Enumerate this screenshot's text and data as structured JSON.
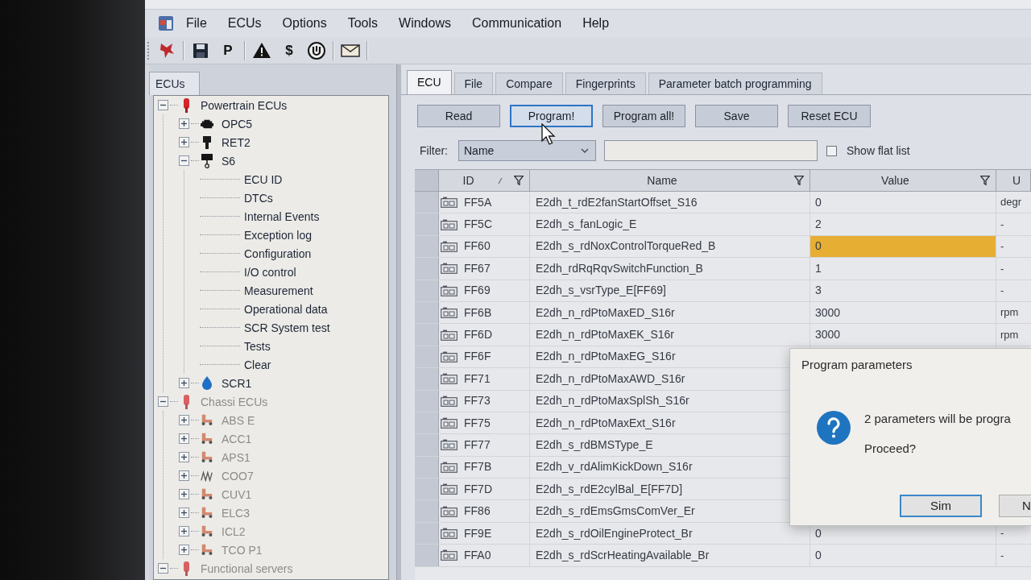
{
  "menu_bar": {
    "items": [
      "File",
      "ECUs",
      "Options",
      "Tools",
      "Windows",
      "Communication",
      "Help"
    ]
  },
  "toolbar": [
    {
      "kind": "emblem"
    },
    {
      "kind": "separator"
    },
    {
      "kind": "save"
    },
    {
      "kind": "glyph",
      "text": "P"
    },
    {
      "kind": "separator"
    },
    {
      "kind": "warning"
    },
    {
      "kind": "glyph",
      "text": "$"
    },
    {
      "kind": "dial"
    },
    {
      "kind": "separator"
    },
    {
      "kind": "mail"
    },
    {
      "kind": "separator"
    }
  ],
  "ecu_panel": {
    "title": "ECUs",
    "tree": [
      {
        "label": "Powertrain ECUs",
        "kind": "group",
        "expanded": true,
        "disabled": false,
        "children": [
          {
            "label": "OPC5",
            "kind": "engine",
            "expanded": false,
            "disabled": false
          },
          {
            "label": "RET2",
            "kind": "retarder",
            "expanded": false,
            "disabled": false
          },
          {
            "label": "S6",
            "kind": "controller",
            "expanded": true,
            "disabled": false,
            "children": [
              {
                "label": "ECU ID",
                "kind": "function"
              },
              {
                "label": "DTCs",
                "kind": "function"
              },
              {
                "label": "Internal Events",
                "kind": "function"
              },
              {
                "label": "Exception log",
                "kind": "function"
              },
              {
                "label": "Configuration",
                "kind": "function"
              },
              {
                "label": "I/O control",
                "kind": "function"
              },
              {
                "label": "Measurement",
                "kind": "function"
              },
              {
                "label": "Operational data",
                "kind": "function"
              },
              {
                "label": "SCR System test",
                "kind": "function"
              },
              {
                "label": "Tests",
                "kind": "function"
              },
              {
                "label": "Clear",
                "kind": "function"
              }
            ]
          },
          {
            "label": "SCR1",
            "kind": "aftertreatment",
            "expanded": false,
            "disabled": false
          }
        ]
      },
      {
        "label": "Chassi ECUs",
        "kind": "group",
        "expanded": true,
        "disabled": true,
        "children": [
          {
            "label": "ABS E",
            "kind": "vehicle",
            "expanded": false,
            "disabled": true
          },
          {
            "label": "ACC1",
            "kind": "vehicle",
            "expanded": false,
            "disabled": true
          },
          {
            "label": "APS1",
            "kind": "vehicle",
            "expanded": false,
            "disabled": true
          },
          {
            "label": "COO7",
            "kind": "cooler",
            "expanded": false,
            "disabled": true
          },
          {
            "label": "CUV1",
            "kind": "vehicle",
            "expanded": false,
            "disabled": true
          },
          {
            "label": "ELC3",
            "kind": "vehicle",
            "expanded": false,
            "disabled": true
          },
          {
            "label": "ICL2",
            "kind": "vehicle",
            "expanded": false,
            "disabled": true
          },
          {
            "label": "TCO P1",
            "kind": "vehicle",
            "expanded": false,
            "disabled": true
          }
        ]
      },
      {
        "label": "Functional servers",
        "kind": "group",
        "expanded": true,
        "disabled": true
      }
    ]
  },
  "main_panel": {
    "tabs": [
      {
        "label": "ECU",
        "selected": true
      },
      {
        "label": "File",
        "selected": false
      },
      {
        "label": "Compare",
        "selected": false
      },
      {
        "label": "Fingerprints",
        "selected": false
      },
      {
        "label": "Parameter batch programming",
        "selected": false
      }
    ],
    "buttons": [
      {
        "label": "Read",
        "focused": false
      },
      {
        "label": "Program!",
        "focused": true
      },
      {
        "label": "Program all!",
        "focused": false
      },
      {
        "label": "Save",
        "focused": false
      },
      {
        "label": "Reset ECU",
        "focused": false
      }
    ],
    "filter": {
      "label": "Filter:",
      "field": "Name",
      "flat_list": {
        "label": "Show flat list",
        "checked": false
      }
    },
    "table": {
      "columns": [
        {
          "label": "ID",
          "sorted": true,
          "filter": true
        },
        {
          "label": "Name",
          "sorted": false,
          "filter": true
        },
        {
          "label": "Value",
          "sorted": false,
          "filter": true
        },
        {
          "label": "U",
          "sorted": false,
          "filter": false
        }
      ],
      "rows": [
        {
          "id": "FF5A",
          "name": "E2dh_t_rdE2fanStartOffset_S16",
          "value": "0",
          "unit": "degr",
          "modified": false
        },
        {
          "id": "FF5C",
          "name": "E2dh_s_fanLogic_E",
          "value": "2",
          "unit": "-",
          "modified": false
        },
        {
          "id": "FF60",
          "name": "E2dh_s_rdNoxControlTorqueRed_B",
          "value": "0",
          "unit": "-",
          "modified": true
        },
        {
          "id": "FF67",
          "name": "E2dh_rdRqRqvSwitchFunction_B",
          "value": "1",
          "unit": "-",
          "modified": false
        },
        {
          "id": "FF69",
          "name": "E2dh_s_vsrType_E[FF69]",
          "value": "3",
          "unit": "-",
          "modified": false
        },
        {
          "id": "FF6B",
          "name": "E2dh_n_rdPtoMaxED_S16r",
          "value": "3000",
          "unit": "rpm",
          "modified": false
        },
        {
          "id": "FF6D",
          "name": "E2dh_n_rdPtoMaxEK_S16r",
          "value": "3000",
          "unit": "rpm",
          "modified": false
        },
        {
          "id": "FF6F",
          "name": "E2dh_n_rdPtoMaxEG_S16r"
        },
        {
          "id": "FF71",
          "name": "E2dh_n_rdPtoMaxAWD_S16r"
        },
        {
          "id": "FF73",
          "name": "E2dh_n_rdPtoMaxSplSh_S16r"
        },
        {
          "id": "FF75",
          "name": "E2dh_n_rdPtoMaxExt_S16r"
        },
        {
          "id": "FF77",
          "name": "E2dh_s_rdBMSType_E"
        },
        {
          "id": "FF7B",
          "name": "E2dh_v_rdAlimKickDown_S16r"
        },
        {
          "id": "FF7D",
          "name": "E2dh_s_rdE2cylBal_E[FF7D]"
        },
        {
          "id": "FF86",
          "name": "E2dh_s_rdEmsGmsComVer_Er"
        },
        {
          "id": "FF9E",
          "name": "E2dh_s_rdOilEngineProtect_Br",
          "value": "0",
          "unit": "-",
          "modified": false
        },
        {
          "id": "FFA0",
          "name": "E2dh_s_rdScrHeatingAvailable_Br",
          "value": "0",
          "unit": "-",
          "modified": false
        }
      ]
    }
  },
  "dialog": {
    "title": "Program parameters",
    "message": "2 parameters will be progra",
    "question": "Proceed?",
    "buttons": [
      {
        "label": "Sim",
        "focused": true
      },
      {
        "label": "N",
        "focused": false
      }
    ]
  }
}
